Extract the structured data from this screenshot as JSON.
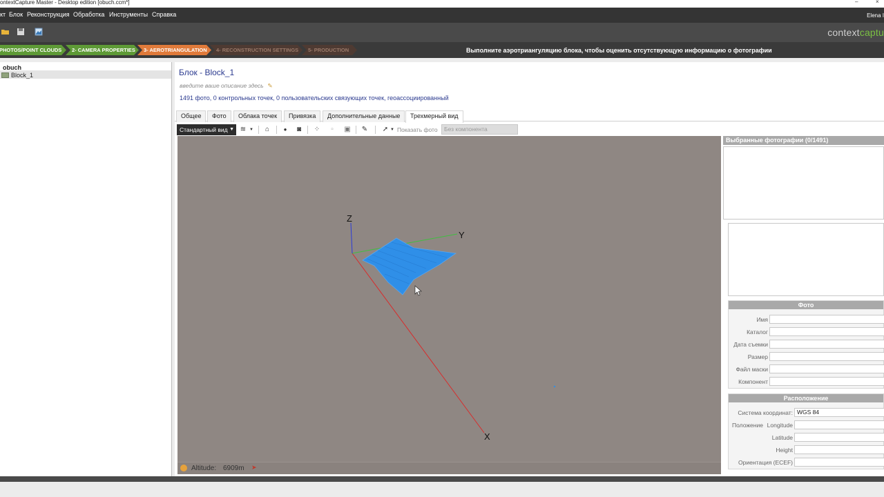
{
  "window": {
    "title": "ontextCapture Master - Desktop edition [obuch.ccm*]",
    "minimize_glyph": "–",
    "close_glyph": "×"
  },
  "menu": {
    "items": [
      "кт",
      "Блок",
      "Реконструкция",
      "Обработка",
      "Инструменты",
      "Справка"
    ],
    "user": "Elena I"
  },
  "brand": {
    "text_main": "context",
    "text_accent": "captu",
    "accent_color": "#7bc043"
  },
  "wizard": {
    "steps": [
      {
        "label": "PHOTOS/POINT CLOUDS",
        "state": "done"
      },
      {
        "label": "2- CAMERA PROPERTIES",
        "state": "done"
      },
      {
        "label": "3- AEROTRIANGULATION",
        "state": "current"
      },
      {
        "label": "4- RECONSTRUCTION SETTINGS",
        "state": "future"
      },
      {
        "label": "5- PRODUCTION",
        "state": "future"
      }
    ],
    "message": "Выполните аэротриангуляцию блока, чтобы оценить отсутствующую информацию о фотографии"
  },
  "tree": {
    "project": "obuch",
    "block": "Block_1"
  },
  "block": {
    "title": "Блок - Block_1",
    "description_placeholder": "введите ваше описание здесь",
    "summary": "1491 фото, 0 контрольных точек, 0 пользовательских связующих точек, геоассоциированный"
  },
  "tabs": [
    "Общее",
    "Фото",
    "Облака точек",
    "Привязка",
    "Дополнительные данные",
    "Трехмерный вид"
  ],
  "active_tab": "Трехмерный вид",
  "viewbar": {
    "view_select": "Стандартный вид",
    "show_photo_label": "Показать фото",
    "component_select": "Без компонента"
  },
  "viewport": {
    "axis_x": "X",
    "axis_y": "Y",
    "axis_z": "Z",
    "altitude_label": "Altitude:",
    "altitude_value": "6909m",
    "axis_colors": {
      "x": "#d92b2b",
      "y": "#3fbf3f",
      "z": "#2b3bd9"
    },
    "cloud_color": "#2f8fe8"
  },
  "selected_photos": {
    "header": "Выбранные фотографии (0/1491)"
  },
  "photo_section": {
    "header": "Фото",
    "fields": [
      {
        "label": "Имя",
        "value": ""
      },
      {
        "label": "Каталог",
        "value": ""
      },
      {
        "label": "Дата съемки",
        "value": ""
      },
      {
        "label": "Размер",
        "value": ""
      },
      {
        "label": "Файл маски",
        "value": ""
      },
      {
        "label": "Компонент",
        "value": ""
      }
    ]
  },
  "location_section": {
    "header": "Расположение",
    "coord_label": "Система координат:",
    "coord_value": "WGS 84",
    "position_label": "Положение",
    "longitude_label": "Longitude",
    "latitude_label": "Latitude",
    "height_label": "Height",
    "orientation_label": "Ориентация (ECEF)"
  }
}
